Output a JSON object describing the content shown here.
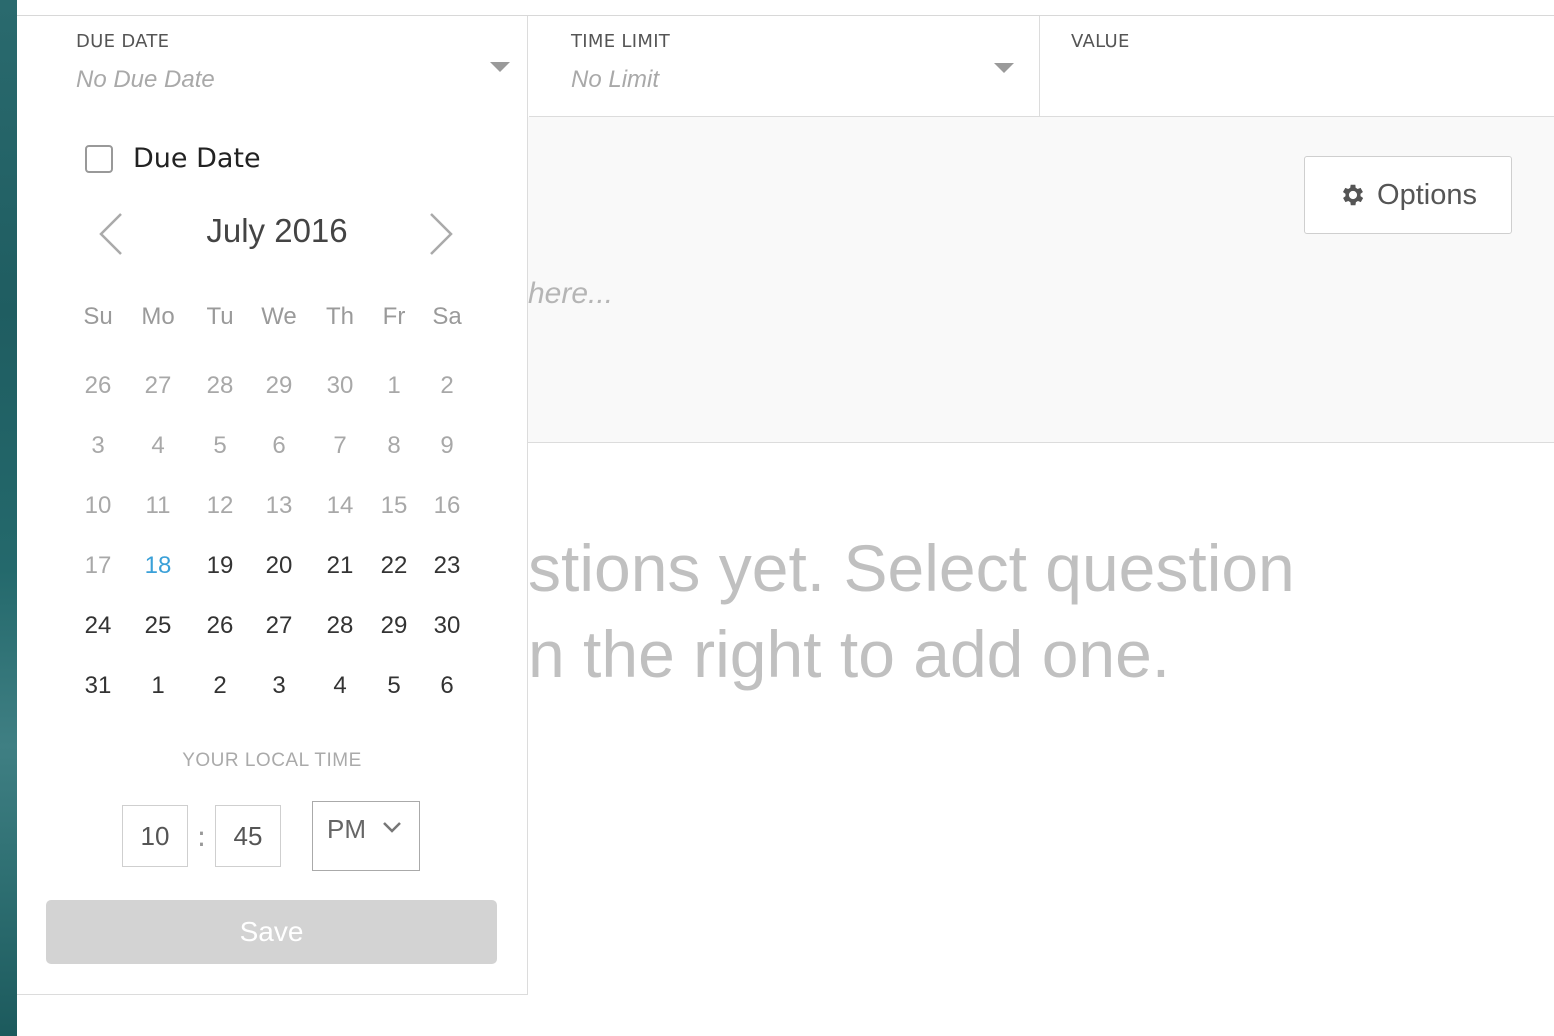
{
  "header": {
    "due_date": {
      "label": "DUE DATE",
      "value": "No Due Date"
    },
    "time_limit": {
      "label": "TIME LIMIT",
      "value": "No Limit"
    },
    "value": {
      "label": "VALUE",
      "value": ""
    }
  },
  "main": {
    "options_label": "Options",
    "description_placeholder_visible": "here...",
    "empty_message_line1": "stions yet. Select question",
    "empty_message_line2": "n the right to add one."
  },
  "due_date_popup": {
    "checkbox_label": "Due Date",
    "checkbox_checked": false,
    "month_title": "July 2016",
    "weekdays": [
      "Su",
      "Mo",
      "Tu",
      "We",
      "Th",
      "Fr",
      "Sa"
    ],
    "weeks": [
      [
        "26",
        "27",
        "28",
        "29",
        "30",
        "1",
        "2"
      ],
      [
        "3",
        "4",
        "5",
        "6",
        "7",
        "8",
        "9"
      ],
      [
        "10",
        "11",
        "12",
        "13",
        "14",
        "15",
        "16"
      ],
      [
        "17",
        "18",
        "19",
        "20",
        "21",
        "22",
        "23"
      ],
      [
        "24",
        "25",
        "26",
        "27",
        "28",
        "29",
        "30"
      ],
      [
        "31",
        "1",
        "2",
        "3",
        "4",
        "5",
        "6"
      ]
    ],
    "today": "18",
    "local_time_label": "YOUR LOCAL TIME",
    "hour": "10",
    "minute": "45",
    "ampm": "PM",
    "save_label": "Save"
  },
  "colors": {
    "today": "#3aa0d8",
    "past_day": "#a8a8a8",
    "save_disabled": "#d3d3d3"
  }
}
